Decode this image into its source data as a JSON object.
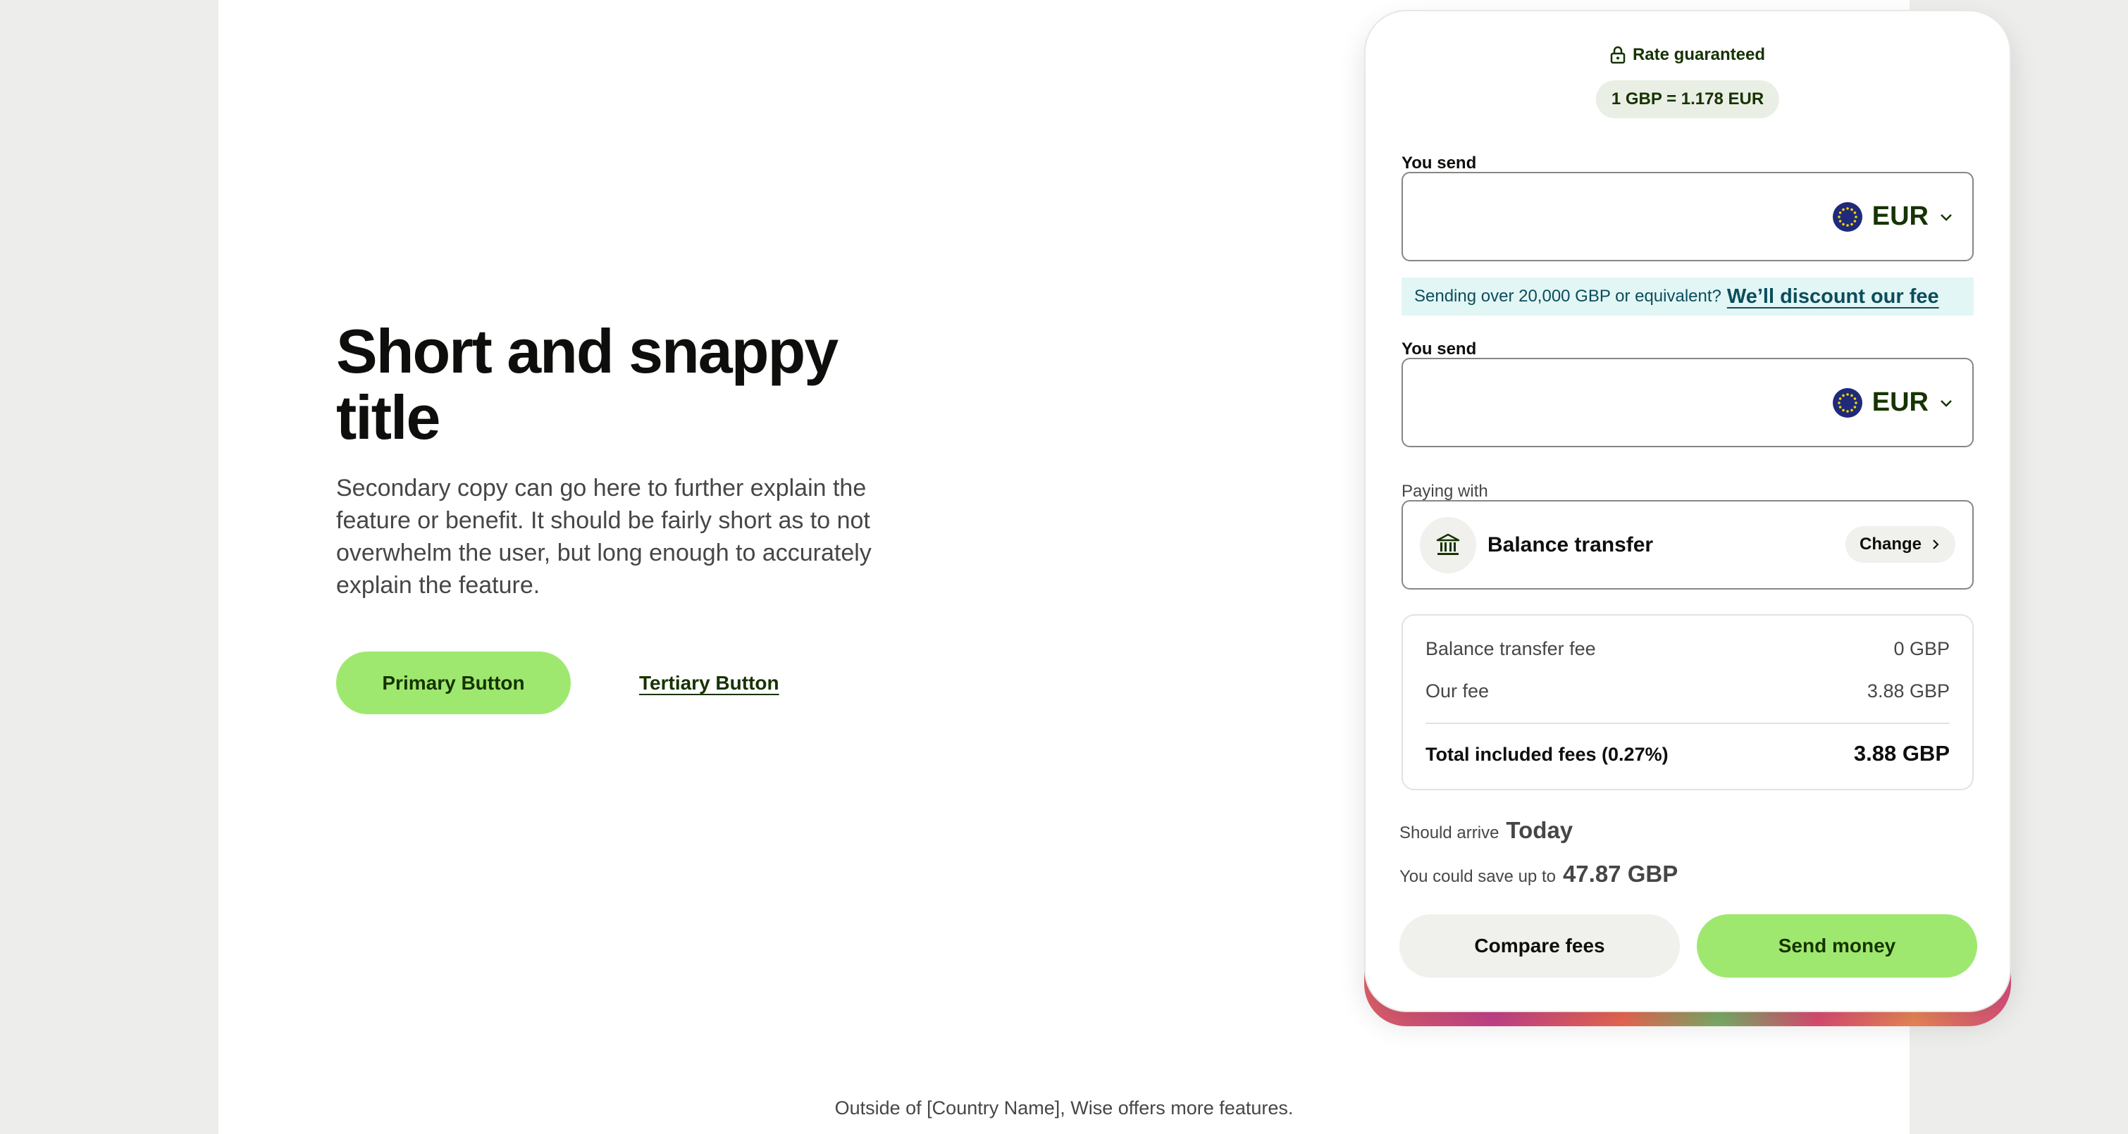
{
  "hero": {
    "title": "Short and snappy title",
    "copy": "Secondary copy can go here to further explain the feature or benefit. It should be fairly short as to not overwhelm the user, but long enough to accurately explain the feature.",
    "primary_button": "Primary Button",
    "tertiary_button": "Tertiary Button"
  },
  "card": {
    "rate_label": "Rate guaranteed",
    "rate_value": "1 GBP = 1.178 EUR",
    "send_field": {
      "label": "You send",
      "value": "",
      "currency": "EUR"
    },
    "discount": {
      "text": "Sending over 20,000 GBP or equivalent?",
      "link": "We’ll discount our fee"
    },
    "receive_field": {
      "label": "You send",
      "value": "",
      "currency": "EUR"
    },
    "paying_with": {
      "label": "Paying with",
      "method": "Balance transfer",
      "change_label": "Change"
    },
    "fees": {
      "rows": [
        {
          "label": "Balance transfer fee",
          "value": "0 GBP"
        },
        {
          "label": "Our fee",
          "value": "3.88 GBP"
        }
      ],
      "total_label": "Total included fees (0.27%)",
      "total_value": "3.88 GBP"
    },
    "arrival": {
      "prefix": "Should arrive",
      "value": "Today"
    },
    "savings": {
      "prefix": "You could save up to",
      "value": "47.87 GBP"
    },
    "compare_button": "Compare fees",
    "send_button": "Send money"
  },
  "footer": {
    "note": "Outside of [Country Name], Wise offers more features."
  },
  "colors": {
    "accent": "#9fe870",
    "accent_text": "#163300",
    "banner_bg": "#e2f6f5",
    "banner_text": "#0b4d5c",
    "page_bg": "#edeeeb"
  }
}
